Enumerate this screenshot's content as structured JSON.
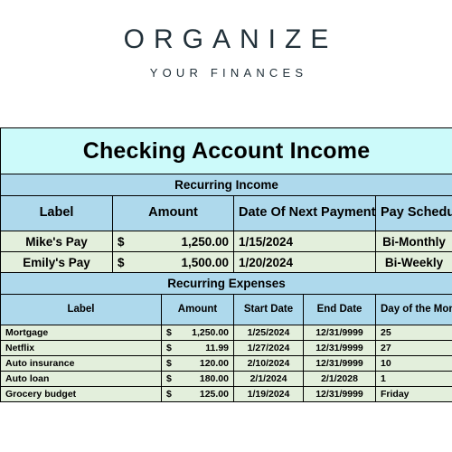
{
  "brand": {
    "title": "ORGANIZE",
    "subtitle": "YOUR FINANCES",
    "title_color": "#22313A"
  },
  "sheet": {
    "title": "Checking Account Income",
    "title_color": "#6B7000",
    "title_bg": "#CCFAFA",
    "header_bg": "#AED9EC",
    "row_bg": "#E3EFDC",
    "income": {
      "section_label": "Recurring Income",
      "columns": [
        "Label",
        "Amount",
        "Date Of Next Payment",
        "Pay Schedule"
      ],
      "rows": [
        {
          "label": "Mike's Pay",
          "currency": "$",
          "amount": "1,250.00",
          "next_payment": "1/15/2024",
          "pay_schedule": "Bi-Monthly"
        },
        {
          "label": "Emily's Pay",
          "currency": "$",
          "amount": "1,500.00",
          "next_payment": "1/20/2024",
          "pay_schedule": "Bi-Weekly"
        }
      ]
    },
    "expenses": {
      "section_label": "Recurring Expenses",
      "columns": [
        "Label",
        "Amount",
        "Start Date",
        "End Date",
        "Day of the Month Paid"
      ],
      "rows": [
        {
          "label": "Mortgage",
          "currency": "$",
          "amount": "1,250.00",
          "start_date": "1/25/2024",
          "end_date": "12/31/9999",
          "day_paid": "25"
        },
        {
          "label": "Netflix",
          "currency": "$",
          "amount": "11.99",
          "start_date": "1/27/2024",
          "end_date": "12/31/9999",
          "day_paid": "27"
        },
        {
          "label": "Auto insurance",
          "currency": "$",
          "amount": "120.00",
          "start_date": "2/10/2024",
          "end_date": "12/31/9999",
          "day_paid": "10"
        },
        {
          "label": "Auto loan",
          "currency": "$",
          "amount": "180.00",
          "start_date": "2/1/2024",
          "end_date": "2/1/2028",
          "day_paid": "1"
        },
        {
          "label": "Grocery budget",
          "currency": "$",
          "amount": "125.00",
          "start_date": "1/19/2024",
          "end_date": "12/31/9999",
          "day_paid": "Friday"
        }
      ]
    }
  }
}
